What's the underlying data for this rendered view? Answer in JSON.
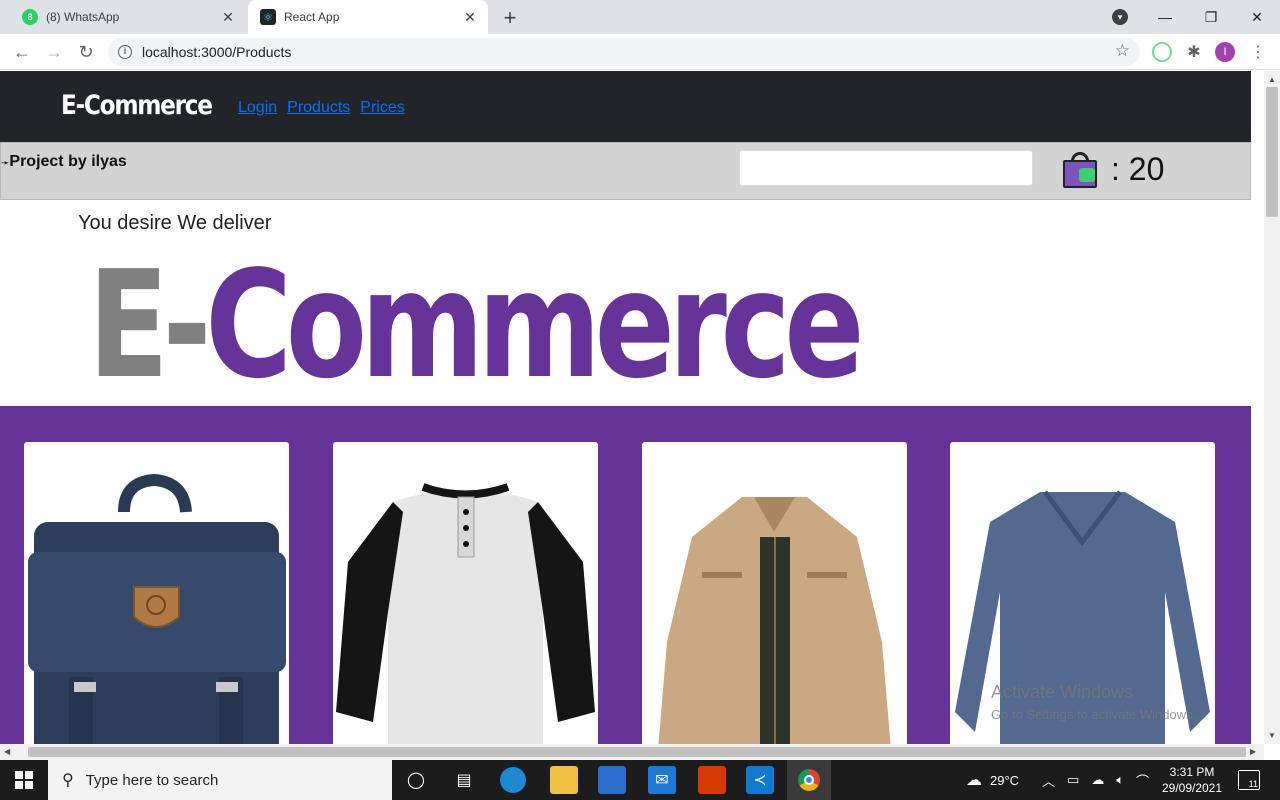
{
  "browser": {
    "tabs": [
      {
        "title": "(8) WhatsApp",
        "badge": "8",
        "active": false
      },
      {
        "title": "React App",
        "active": true
      }
    ],
    "url": "localhost:3000/Products",
    "profile_initial": "I"
  },
  "navbar": {
    "brand": "E-Commerce",
    "links": [
      "Login",
      "Products",
      "Prices"
    ]
  },
  "subbar": {
    "credit": "Project by ilyas",
    "search_value": "",
    "cart_count": ": 20"
  },
  "hero": {
    "tagline": "You desire We deliver",
    "logo_part1": "E-",
    "logo_part2": "Commerce"
  },
  "products": [
    {
      "name": "Navy backpack"
    },
    {
      "name": "Raglan henley t-shirt"
    },
    {
      "name": "Beige jacket"
    },
    {
      "name": "Blue v-neck sweater"
    }
  ],
  "watermark": {
    "line1": "Activate Windows",
    "line2": "Go to Settings to activate Windows."
  },
  "taskbar": {
    "search_placeholder": "Type here to search",
    "weather": "29°C",
    "time": "3:31 PM",
    "date": "29/09/2021",
    "notifications": "11"
  },
  "colors": {
    "navbar_bg": "#212529",
    "accent": "#663399",
    "link": "#0d6efd",
    "subbar_bg": "#d3d3d3"
  }
}
